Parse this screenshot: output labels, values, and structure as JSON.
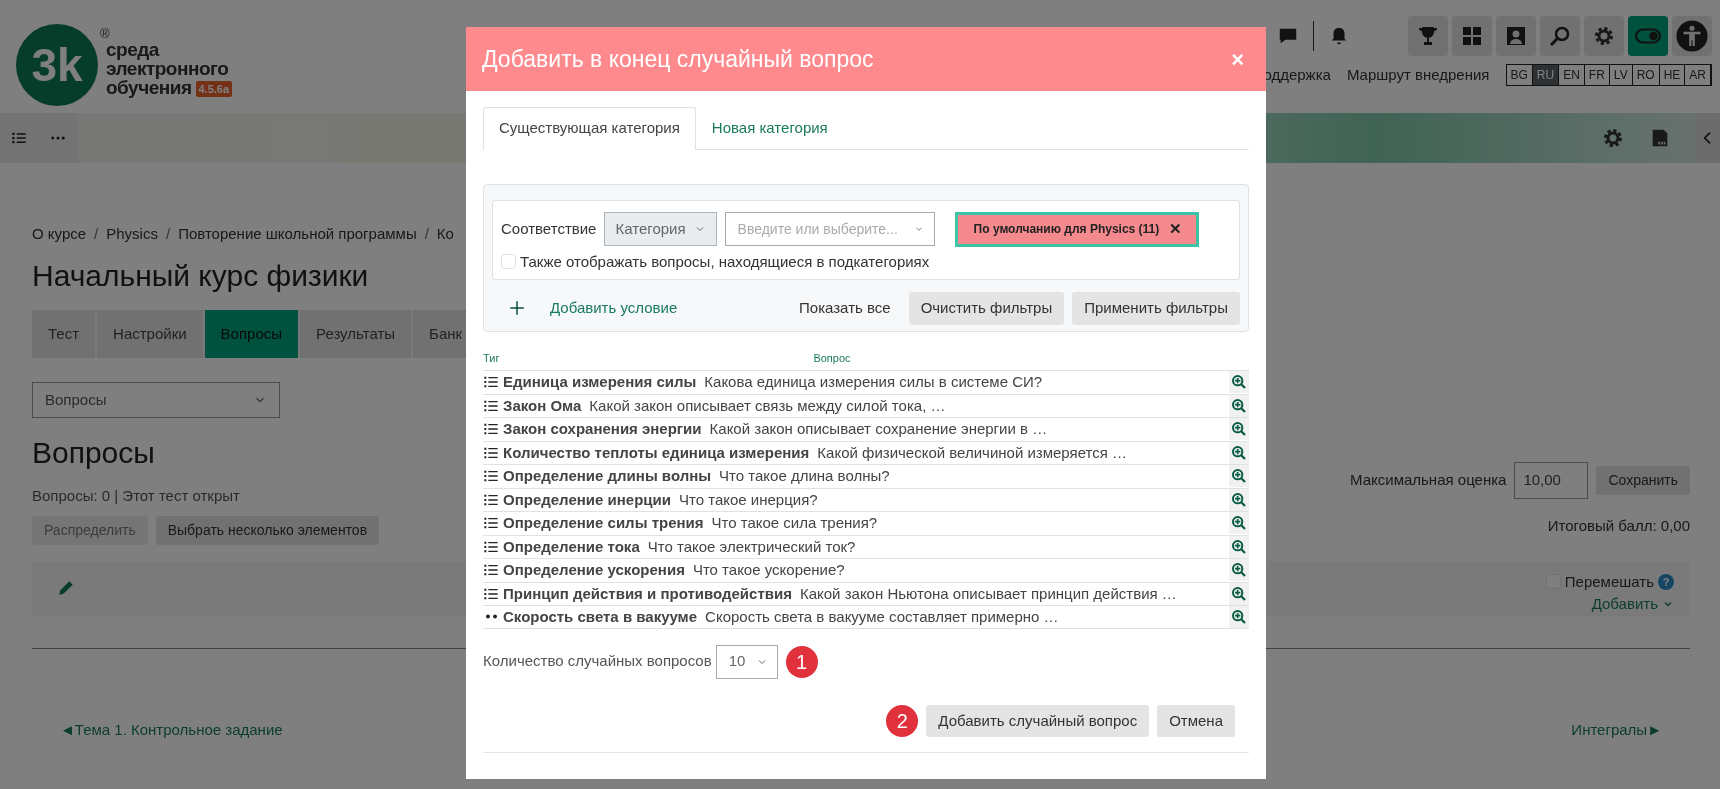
{
  "header": {
    "logo": {
      "mark": "3k",
      "registered": "®",
      "lines": [
        "среда",
        "электронного",
        "обучения"
      ],
      "version": "4.5.6a"
    },
    "top_links": [
      "оддержка",
      "Маршрут внедрения"
    ],
    "theme_toggle": {
      "on": true
    },
    "languages": [
      {
        "label": "BG",
        "selected": false
      },
      {
        "label": "RU",
        "selected": true
      },
      {
        "label": "EN",
        "selected": false
      },
      {
        "label": "FR",
        "selected": false
      },
      {
        "label": "LV",
        "selected": false
      },
      {
        "label": "RO",
        "selected": false
      },
      {
        "label": "HE",
        "selected": false
      },
      {
        "label": "AR",
        "selected": false
      }
    ]
  },
  "breadcrumb": [
    {
      "kind": "link",
      "text": "О курсе"
    },
    {
      "kind": "separator",
      "text": "/"
    },
    {
      "kind": "link",
      "text": "Physics"
    },
    {
      "kind": "separator",
      "text": "/"
    },
    {
      "kind": "link",
      "text": "Повторение школьной программы"
    },
    {
      "kind": "separator",
      "text": "/"
    },
    {
      "kind": "link",
      "text": "Ко"
    }
  ],
  "page_title": "Начальный курс физики",
  "tabs": [
    {
      "label": "Тест",
      "selected": false
    },
    {
      "label": "Настройки",
      "selected": false
    },
    {
      "label": "Вопросы",
      "selected": true
    },
    {
      "label": "Результаты",
      "selected": false
    },
    {
      "label": "Банк",
      "selected": false
    }
  ],
  "view_select": {
    "value": "Вопросы"
  },
  "section_title": "Вопросы",
  "status": "Вопросы: 0 | Этот тест открыт",
  "actions": [
    {
      "label": "Распределить",
      "disabled": true
    },
    {
      "label": "Выбрать несколько элементов",
      "disabled": false
    }
  ],
  "grade": {
    "label": "Максимальная оценка",
    "value": "10,00",
    "button": "Сохранить"
  },
  "total": "Итоговый балл: 0,00",
  "shuffle": {
    "label": "Перемешать",
    "checked": false,
    "help": "?"
  },
  "add_menu": "Добавить",
  "nav": {
    "prev": "◄Тема 1. Контрольное задание",
    "next": "Интегралы►"
  },
  "modal": {
    "title": "Добавить в конец случайный вопрос",
    "close": "×",
    "tabs": [
      {
        "label": "Существующая категория",
        "selected": true
      },
      {
        "label": "Новая категория",
        "selected": false
      }
    ],
    "filter": {
      "match_label": "Соответствие",
      "type_select": "Категория",
      "search_placeholder": "Введите или выберите...",
      "chip": {
        "label": "По умолчанию для Physics (11)",
        "remove": "✕"
      },
      "subcategories": {
        "label": "Также отображать вопросы, находящиеся в подкатегориях",
        "checked": false
      },
      "add_condition": "Добавить условие",
      "show_all": "Показать все",
      "buttons": [
        "Очистить фильтры",
        "Применить фильтры"
      ]
    },
    "columns": [
      "Тиг",
      "Вопрос"
    ],
    "questions": [
      {
        "kind": "list",
        "name": "Единица измерения силы",
        "text": "Какова единица измерения силы в системе СИ?"
      },
      {
        "kind": "list",
        "name": "Закон Ома",
        "text": "Какой закон описывает связь между силой тока, …"
      },
      {
        "kind": "list",
        "name": "Закон сохранения энергии",
        "text": "Какой закон описывает сохранение энергии в …"
      },
      {
        "kind": "list",
        "name": "Количество теплоты единица измерения",
        "text": "Какой физической величиной измеряется …"
      },
      {
        "kind": "list",
        "name": "Определение длины волны",
        "text": "Что такое длина волны?"
      },
      {
        "kind": "list",
        "name": "Определение инерции",
        "text": "Что такое инерция?"
      },
      {
        "kind": "list",
        "name": "Определение силы трения",
        "text": "Что такое сила трения?"
      },
      {
        "kind": "list",
        "name": "Определение тока",
        "text": "Что такое электрический ток?"
      },
      {
        "kind": "list",
        "name": "Определение ускорения",
        "text": "Что такое ускорение?"
      },
      {
        "kind": "list",
        "name": "Принцип действия и противодействия",
        "text": "Какой закон Ньютона описывает принцип действия …"
      },
      {
        "kind": "dots",
        "name": "Скорость света в вакууме",
        "text": "Скорость света в вакууме составляет примерно …"
      }
    ],
    "count": {
      "label": "Количество случайных вопросов",
      "value": "10",
      "marker": "1"
    },
    "buttons": [
      {
        "label": "Добавить случайный вопрос",
        "marker": "2"
      },
      {
        "label": "Отмена"
      }
    ]
  }
}
